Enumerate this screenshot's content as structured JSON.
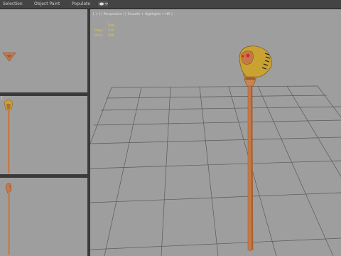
{
  "menu": {
    "tabs": [
      {
        "label": "Selection"
      },
      {
        "label": "Object Paint"
      },
      {
        "label": "Populate"
      }
    ]
  },
  "viewports": {
    "top": {
      "label": ""
    },
    "front": {
      "label": "["
    },
    "left": {
      "label": ""
    },
    "perspective": {
      "label": "[ + ] [ Perspective ] [ Smooth + Highlights + HR ]",
      "stats": {
        "total_label": "Total",
        "polys_label": "Polys:",
        "polys_value": "316",
        "verts_label": "Verts:",
        "verts_value": "298"
      }
    }
  },
  "colors": {
    "viewport_bg": "#9e9e9e",
    "grid": "#5a5a5a",
    "staff_wood": "#c47a48",
    "snake_gold": "#c9a232",
    "snake_eye": "#d42a2a"
  }
}
